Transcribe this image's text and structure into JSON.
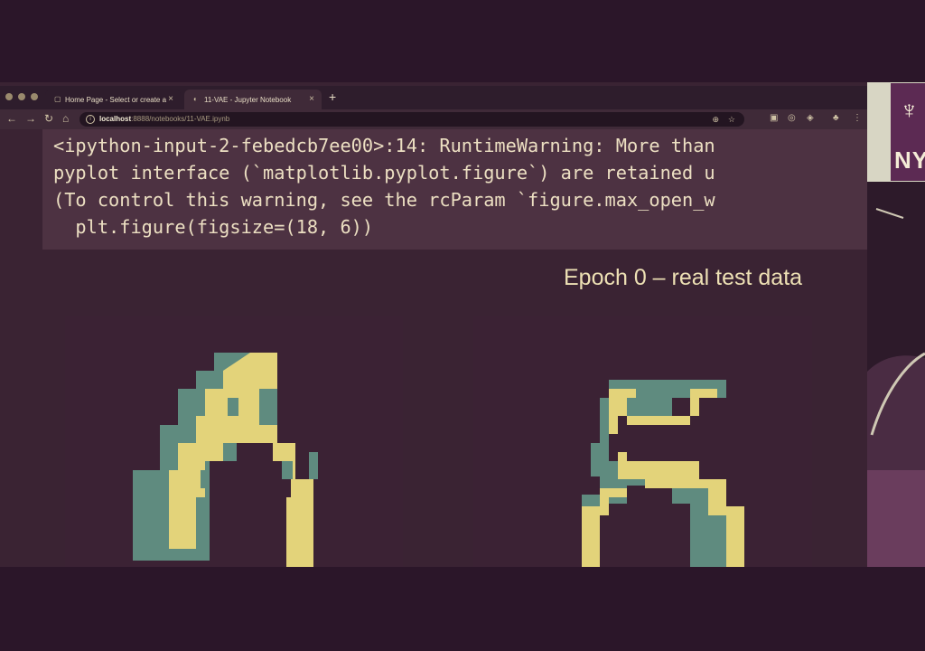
{
  "browser": {
    "tabs": [
      {
        "title": "Home Page - Select or create a",
        "active": false
      },
      {
        "title": "11-VAE - Jupyter Notebook",
        "active": true
      }
    ],
    "new_tab_label": "+",
    "url_host": "localhost",
    "url_path": ":8888/notebooks/11-VAE.ipynb"
  },
  "notebook": {
    "warning_lines": [
      "<ipython-input-2-febedcb7ee00>:14: RuntimeWarning: More than",
      "pyplot interface (`matplotlib.pyplot.figure`) are retained u",
      "(To control this warning, see the rcParam `figure.max_open_w",
      "  plt.figure(figsize=(18, 6))"
    ],
    "figure_title": "Epoch 0 – real test data",
    "digits": [
      "6",
      "5"
    ]
  },
  "webcam": {
    "logo_text": "NY"
  },
  "colors": {
    "background": "#2b1629",
    "output_bg": "#4d3242",
    "digit_fill": "#e3d37a",
    "digit_edge": "#5f8b7f",
    "digit_bg": "#3b2234"
  },
  "icons": [
    "info-icon",
    "back-icon",
    "forward-icon",
    "reload-icon",
    "home-icon",
    "zoom-icon",
    "bookmark-star-icon",
    "extension-icon",
    "menu-icon"
  ]
}
